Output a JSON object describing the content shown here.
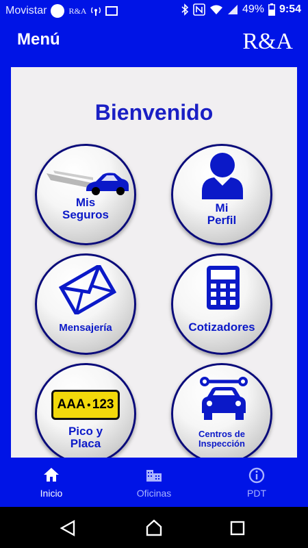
{
  "status_bar": {
    "carrier": "Movistar",
    "brand_small": "R&A",
    "battery": "49%",
    "time": "9:54",
    "icons": [
      "circle-icon",
      "ra-logo-icon",
      "antenna-icon",
      "sim-icon",
      "bluetooth-icon",
      "nfc-icon",
      "wifi-icon",
      "signal-icon",
      "battery-icon"
    ]
  },
  "app_bar": {
    "title": "Menú",
    "logo": "R&A"
  },
  "welcome": "Bienvenido",
  "menu": [
    {
      "line1": "Mis",
      "line2": "Seguros",
      "icon": "car-speed-icon"
    },
    {
      "line1": "Mi",
      "line2": "Perfil",
      "icon": "user-icon"
    },
    {
      "line1": "Mensajería",
      "line2": "",
      "icon": "envelope-icon"
    },
    {
      "line1": "Cotizadores",
      "line2": "",
      "icon": "calculator-icon"
    },
    {
      "line1": "Pico y",
      "line2": "Placa",
      "icon": "license-plate-icon",
      "plate": "AAA",
      "plate_num": "123"
    },
    {
      "line1": "Centros de",
      "line2": "Inspección",
      "icon": "car-wrench-icon"
    }
  ],
  "bottom_nav": [
    {
      "label": "Inicio",
      "icon": "home-icon",
      "active": true
    },
    {
      "label": "Oficinas",
      "icon": "building-icon",
      "active": false
    },
    {
      "label": "PDT",
      "icon": "info-icon",
      "active": false
    }
  ],
  "colors": {
    "primary": "#0014e6",
    "tile_text": "#0b19c8",
    "background": "#f1eff1",
    "active_nav": "#ffffff",
    "inactive_nav": "#aab4ff"
  }
}
